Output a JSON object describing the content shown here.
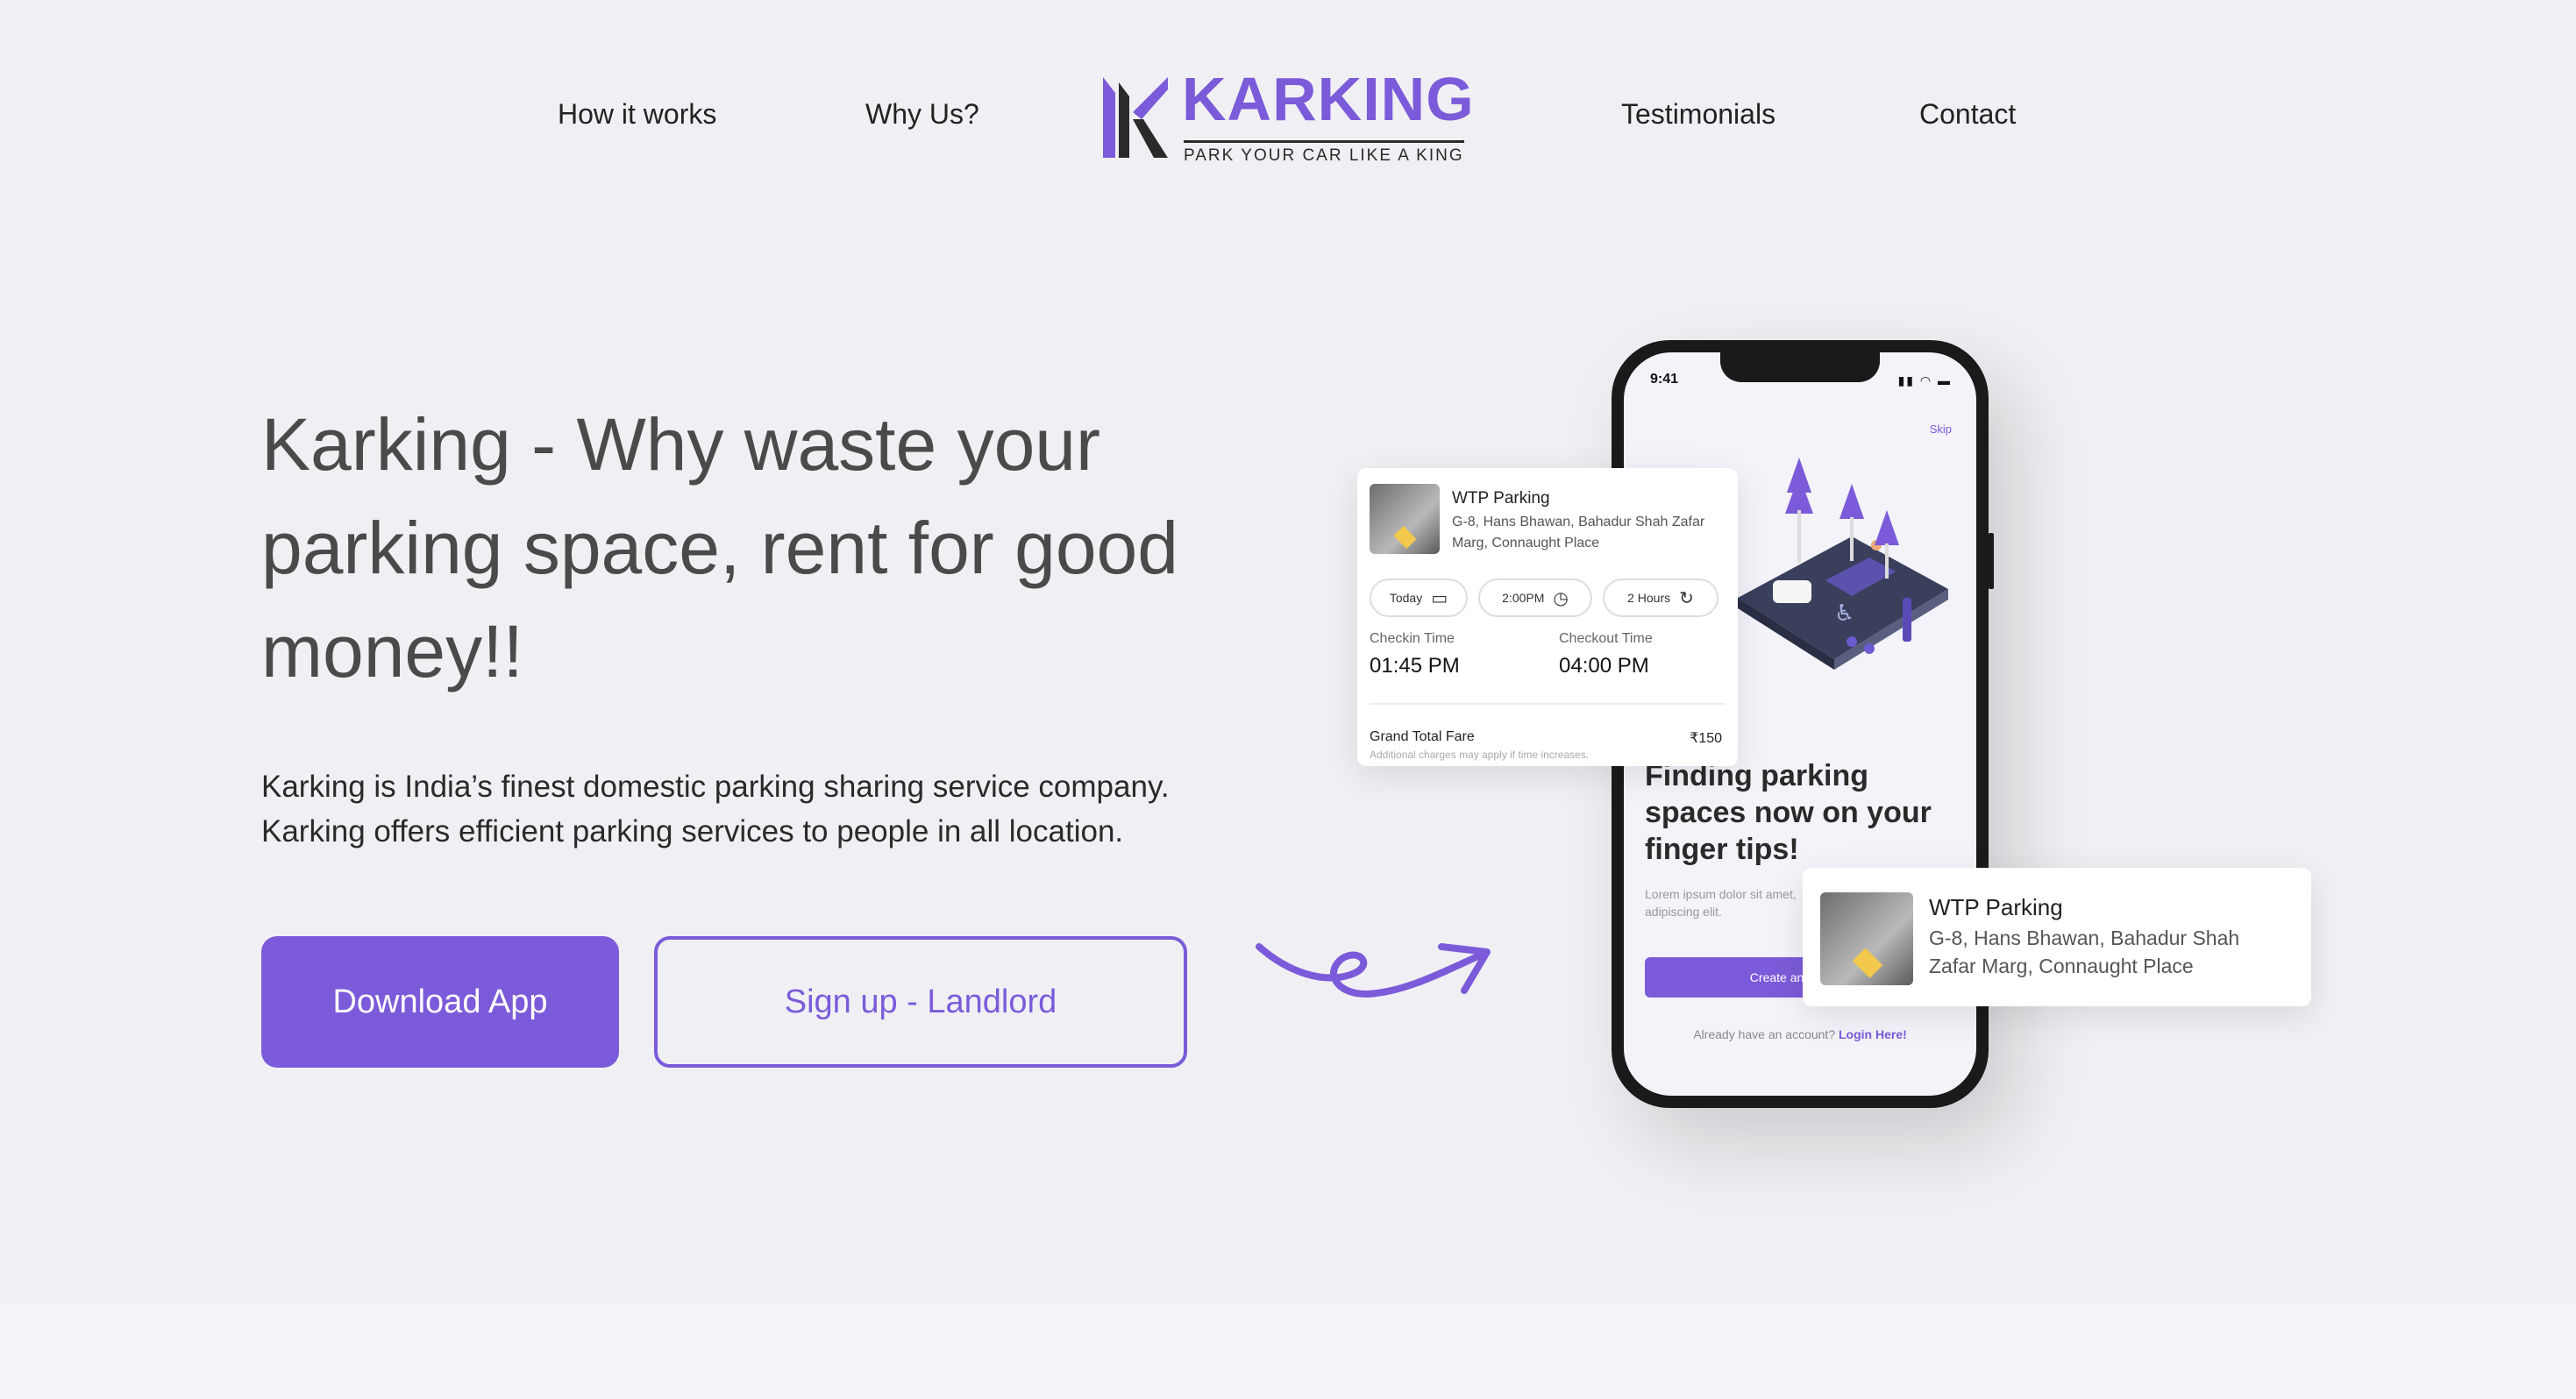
{
  "nav": {
    "links": [
      "How it works",
      "Why Us?",
      "Testimonials",
      "Contact"
    ]
  },
  "logo": {
    "name": "KARKING",
    "tagline": "PARK YOUR CAR LIKE A KING"
  },
  "hero": {
    "title": "Karking - Why waste your parking space, rent for good money!!",
    "description_line1": "Karking is India’s finest domestic parking sharing service company.",
    "description_line2": "Karking offers efficient parking services to people in all location.",
    "primary_button": "Download App",
    "secondary_button": "Sign up - Landlord"
  },
  "phone": {
    "time": "9:41",
    "skip": "Skip",
    "headline": "Finding parking spaces now on your finger tips!",
    "lorem": "Lorem ipsum dolor sit amet, adipiscing elit.",
    "create_button": "Create an account",
    "login_prompt": "Already have an account?",
    "login_link": "Login Here!"
  },
  "booking_card": {
    "title": "WTP Parking",
    "address": "G-8, Hans Bhawan, Bahadur Shah Zafar Marg, Connaught Place",
    "chips": [
      "Today",
      "2:00PM",
      "2 Hours"
    ],
    "checkin_label": "Checkin Time",
    "checkin_value": "01:45 PM",
    "checkout_label": "Checkout Time",
    "checkout_value": "04:00 PM",
    "grand_total_label": "Grand Total Fare",
    "grand_total_value": "₹150",
    "note": "Additional charges may apply if time increases."
  },
  "location_card": {
    "title": "WTP Parking",
    "address_line1": "G-8, Hans Bhawan, Bahadur Shah",
    "address_line2": "Zafar Marg, Connaught Place"
  },
  "colors": {
    "accent": "#7b5bd9",
    "background": "#f0f0f4"
  }
}
